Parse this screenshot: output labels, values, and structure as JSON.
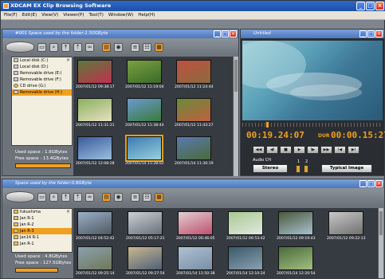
{
  "app": {
    "title": "XDCAM EX Clip Browsing Software"
  },
  "menu": [
    "File(F)",
    "Edit(E)",
    "View(V)",
    "Viewer(P)",
    "Tool(T)",
    "Window(W)",
    "Help(H)"
  ],
  "top_panel": {
    "title": "#001  Space used by the folder:1.50GByte",
    "tree": [
      {
        "label": "Local disk (C:)",
        "icon": "drive"
      },
      {
        "label": "Local disk (D:)",
        "icon": "drive"
      },
      {
        "label": "Removable drive (E:)",
        "icon": "drive"
      },
      {
        "label": "Removable drive (F:)",
        "icon": "drive"
      },
      {
        "label": "CD drive (G:)",
        "icon": "disc"
      },
      {
        "label": "Removable drive (H:)",
        "icon": "drive",
        "selected": true
      }
    ],
    "used_space": "Used space : 1.6GBytes",
    "free_space": "Free space : 13.4GBytes",
    "thumbs": [
      {
        "caption": "2007/01/12 09:38:17",
        "c1": "#5a7a3a",
        "c2": "#c03050"
      },
      {
        "caption": "2007/01/12 11:19:04",
        "c1": "#7aa040",
        "c2": "#3a6a2a"
      },
      {
        "caption": "2007/01/12 11:24:44",
        "c1": "#c05040",
        "c2": "#8a6a40"
      },
      {
        "caption": "2007/01/12 11:31:21",
        "c1": "#8ab060",
        "c2": "#e8e0c0"
      },
      {
        "caption": "2007/01/12 11:38:44",
        "c1": "#6a9ad0",
        "c2": "#3a7a3a"
      },
      {
        "caption": "2007/01/12 11:43:27",
        "c1": "#6a8a3a",
        "c2": "#c06040"
      },
      {
        "caption": "2007/01/12 12:08:28",
        "c1": "#3a5a9a",
        "c2": "#9ac0e0"
      },
      {
        "caption": "2007/01/14 11:28:02",
        "c1": "#3a7ab0",
        "c2": "#9ad0e0",
        "selected": true
      },
      {
        "caption": "2007/01/14 11:30:19",
        "c1": "#5a7ab0",
        "c2": "#4a6a3a"
      }
    ]
  },
  "player": {
    "title": "Untitled",
    "timecode": "00:19.24:07",
    "dur_label": "DUR",
    "duration": "00:00.15:27",
    "transport": [
      "◀◀",
      "◀I",
      "■",
      "▶",
      "I▶",
      "▶▶",
      "I◀",
      "▶I"
    ],
    "audio_ch": "Audio CH",
    "stereo": "Stereo",
    "ch1": "1",
    "ch2": "2",
    "typical_image": "Typical Image"
  },
  "bottom_panel": {
    "title": "Space used by the folder:0.8GByte",
    "tree": [
      {
        "label": "fukushima",
        "icon": "folder"
      },
      {
        "label": "Jan R-1",
        "icon": "folder"
      },
      {
        "label": "Jan R-2",
        "icon": "folder"
      },
      {
        "label": "Jan R-3",
        "icon": "folder",
        "selected": true
      },
      {
        "label": "Jan14 R-1",
        "icon": "folder"
      },
      {
        "label": "Jan R-1",
        "icon": "folder"
      }
    ],
    "used_space": "Used space : 4.8GBytes",
    "free_space": "Free space : 127.5GBytes",
    "thumbs": [
      {
        "caption": "2007/01/12 04:52:42",
        "c1": "#9ab0c8",
        "c2": "#505860"
      },
      {
        "caption": "2007/01/12 05:17:21",
        "c1": "#c8d0d8",
        "c2": "#6a7078"
      },
      {
        "caption": "2007/01/12 06:46:05",
        "c1": "#e0d0d0",
        "c2": "#c05070"
      },
      {
        "caption": "2007/01/12 06:53:42",
        "c1": "#aac890",
        "c2": "#e0e8e0"
      },
      {
        "caption": "2007/01/12 09:19:43",
        "c1": "#4a5a3a",
        "c2": "#a8c0d0"
      },
      {
        "caption": "2007/01/12 09:22:13",
        "c1": "#c8c8c8",
        "c2": "#707070"
      },
      {
        "caption": "2007/01/12 09:25:14",
        "c1": "#8aa0b0",
        "c2": "#707858"
      },
      {
        "caption": "2007/01/12 09:27:54",
        "c1": "#c8b890",
        "c2": "#506078"
      },
      {
        "caption": "2007/01/14 11:50:38",
        "c1": "#b0c0d0",
        "c2": "#7890a8"
      },
      {
        "caption": "2007/01/14 12:10:24",
        "c1": "#3a5a6a",
        "c2": "#8aa0b0"
      },
      {
        "caption": "2007/01/14 12:20:54",
        "c1": "#4a6a3a",
        "c2": "#a0c080"
      }
    ]
  }
}
